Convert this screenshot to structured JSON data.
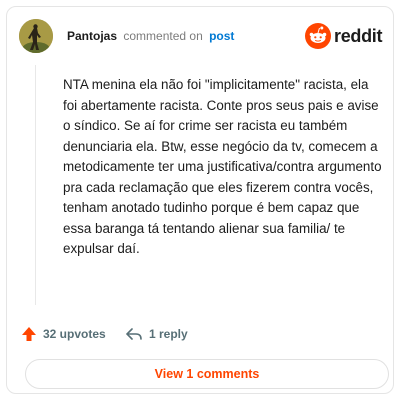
{
  "header": {
    "username": "Pantojas",
    "action_text": "commented on",
    "post_link": "post",
    "brand_word": "reddit",
    "brand_color": "#ff4500"
  },
  "comment": {
    "text": "NTA menina ela não foi \"implicitamente\" racista, ela foi abertamente racista. Conte pros seus pais e avise o síndico. Se aí for crime ser racista eu também denunciaria ela. Btw, esse negócio da tv, comecem a metodicamente ter uma justificativa/contra argumento pra cada reclamação que eles fizerem contra vocês, tenham anotado tudinho porque é bem capaz que essa baranga tá tentando alienar sua familia/ te expulsar daí."
  },
  "actions": {
    "upvotes_label": "32 upvotes",
    "reply_label": "1 reply",
    "upvote_icon": "upvote-arrow-icon",
    "reply_icon": "reply-arrow-icon"
  },
  "footer": {
    "view_comments_label": "View 1 comments"
  }
}
